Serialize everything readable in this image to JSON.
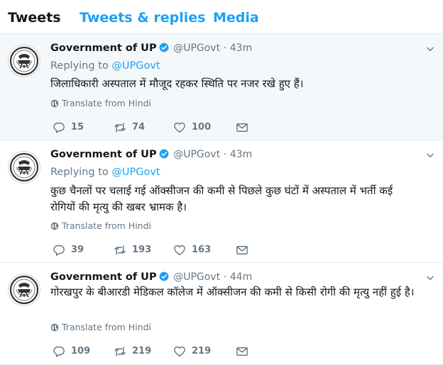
{
  "tabs": [
    {
      "label": "Tweets",
      "active": true
    },
    {
      "label": "Tweets & replies",
      "active": false
    },
    {
      "label": "Media",
      "active": false
    }
  ],
  "colors": {
    "accent": "#1da1f2",
    "text": "#14171a",
    "secondary": "#657786",
    "border": "#e6ecf0",
    "highlight_bg": "#f5f8fa"
  },
  "icons": {
    "avatar": "state-emblem-logo",
    "verified": "verified-badge-icon",
    "caret": "chevron-down-icon",
    "translate": "globe-icon",
    "reply": "reply-icon",
    "retweet": "retweet-icon",
    "like": "heart-icon",
    "dm": "envelope-icon"
  },
  "tweets": [
    {
      "name": "Government of UP",
      "handle": "@UPGovt",
      "separator": "·",
      "time": "43m",
      "reply_prefix": "Replying to",
      "reply_to": "@UPGovt",
      "text": "जिलाधिकारी अस्पताल में मौजूद रहकर स्थिति पर नजर रखे हुए हैं।",
      "translate": "Translate from Hindi",
      "replies": "15",
      "retweets": "74",
      "likes": "100"
    },
    {
      "name": "Government of UP",
      "handle": "@UPGovt",
      "separator": "·",
      "time": "43m",
      "reply_prefix": "Replying to",
      "reply_to": "@UPGovt",
      "text": "कुछ चैनलों पर चलाई गई ऑक्सीजन की कमी से पिछले कुछ घंटों में अस्पताल में भर्ती कई रोगियों की मृत्यु की खबर भ्रामक है।",
      "translate": "Translate from Hindi",
      "replies": "39",
      "retweets": "193",
      "likes": "163"
    },
    {
      "name": "Government of UP",
      "handle": "@UPGovt",
      "separator": "·",
      "time": "44m",
      "text": "गोरखपुर के बीआरडी मेडिकल कॉलेज में ऑक्सीजन की कमी से किसी रोगी की मृत्यु नहीं हुई है।",
      "translate": "Translate from Hindi",
      "replies": "109",
      "retweets": "219",
      "likes": "219"
    }
  ]
}
